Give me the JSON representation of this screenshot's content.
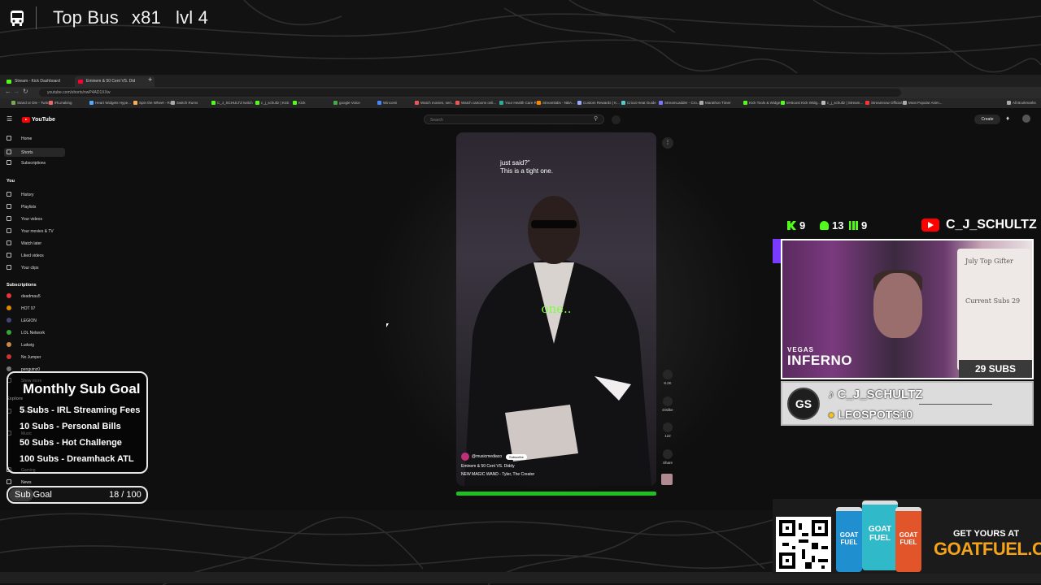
{
  "overlay": {
    "title": "Top Bus",
    "multiplier": "x81",
    "level": "lvl 4"
  },
  "browser": {
    "tabs": [
      {
        "label": "Stream - Kick Dashboard",
        "color": "#53fc18"
      },
      {
        "label": "Eminem & 50 Cent VS. Did",
        "color": "#ff0033"
      }
    ],
    "url": "youtube.com/shorts/nwP4AD1XXw",
    "bookmarks": [
      "Stand or Die - Twitch",
      "IRLmaking",
      "Heart Widgets Hype...",
      "Spin the Wheel - Ra...",
      "Switch Rums",
      "C_J_SCHULTZ twitch",
      "c_j_schultz | Kick",
      "Kick",
      "google Voice",
      "Wincomi",
      "Watch movies, seri...",
      "Watch cartoons onli...",
      "Your Health Care Re...",
      "Streamlabs - NBA...",
      "Custom Rewards | K...",
      "Cricut Heat Guide",
      "StreamLadder - Cro...",
      "Marathon Timer",
      "Kick Tools & Widge...",
      "M-Boost Kick Widg...",
      "c_j_schultz | Stream...",
      "Streamnow Official...",
      "Most Popular Anim...",
      "All Bookmarks"
    ]
  },
  "youtube": {
    "logo": "YouTube",
    "search_placeholder": "Search",
    "create": "Create",
    "nav": [
      {
        "label": "Home",
        "icon": "home-icon"
      },
      {
        "label": "Shorts",
        "icon": "shorts-icon"
      },
      {
        "label": "Subscriptions",
        "icon": "subscriptions-icon"
      }
    ],
    "you_header": "You",
    "you_items": [
      "History",
      "Playlists",
      "Your videos",
      "Your movies & TV",
      "Watch later",
      "Liked videos",
      "Your clips"
    ],
    "subs_header": "Subscriptions",
    "subs": [
      {
        "label": "deadmau5",
        "color": "#e33"
      },
      {
        "label": "HOT 97",
        "color": "#d80"
      },
      {
        "label": "LEGION",
        "color": "#447"
      },
      {
        "label": "LOL Network",
        "color": "#3a3"
      },
      {
        "label": "Ludwig",
        "color": "#c84"
      },
      {
        "label": "No Jumper",
        "color": "#c33"
      },
      {
        "label": "penguinz0",
        "color": "#777"
      }
    ],
    "show_more": "Show more",
    "explore_header": "Explore",
    "explore_items": [
      "Shopping",
      "Music",
      "Gaming",
      "News"
    ],
    "video": {
      "caption_top_1": "just said?\"",
      "caption_top_2": "This is a tight one.",
      "caption_big": "one..",
      "channel": "@musicmediaco",
      "subscribe": "Subscribe",
      "title": "Eminem & 50 Cent VS. Diddy",
      "sound": "NEW MAGIC WAND - Tyler, The Creator"
    },
    "actions": [
      {
        "label": "8.2K",
        "icon": "like-icon"
      },
      {
        "label": "Dislike",
        "icon": "dislike-icon"
      },
      {
        "label": "122",
        "icon": "comment-icon"
      },
      {
        "label": "Share",
        "icon": "share-icon"
      }
    ]
  },
  "sub_goal_panel": {
    "title": "Monthly Sub Goal",
    "items": [
      "5 Subs - IRL Streaming Fees",
      "10 Subs - Personal Bills",
      "50 Subs - Hot Challenge",
      "100 Subs - Dreamhack ATL"
    ],
    "bar_label": "Sub Goal",
    "bar_value": "18 / 100",
    "progress": 0.18
  },
  "stats": {
    "kick": "9",
    "follows": "13",
    "bars": "9",
    "youtube_name": "C_J_SCHULTZ"
  },
  "webcam": {
    "board_text": "July Top Gifter",
    "board_sub": "Current Subs 29",
    "vegas": "VEGAS",
    "inferno": "INFERNO",
    "subs_badge": "29 SUBS"
  },
  "name_panel": {
    "logo": "GS",
    "tiktok_name": "C_J_SCHULTZ",
    "supporter": "LEOSPOTS10"
  },
  "ad": {
    "line1": "GET YOURS AT",
    "line2": "GOATFUEL.COM",
    "can_label": "GOAT FUEL",
    "can_colors": [
      "#1f8fd0",
      "#2fb9c9",
      "#e2552a"
    ]
  },
  "colors": {
    "kick_green": "#53fc18",
    "youtube_red": "#ff0000",
    "caption_green": "#7CFF3C",
    "goat_orange": "#f4a31a"
  }
}
